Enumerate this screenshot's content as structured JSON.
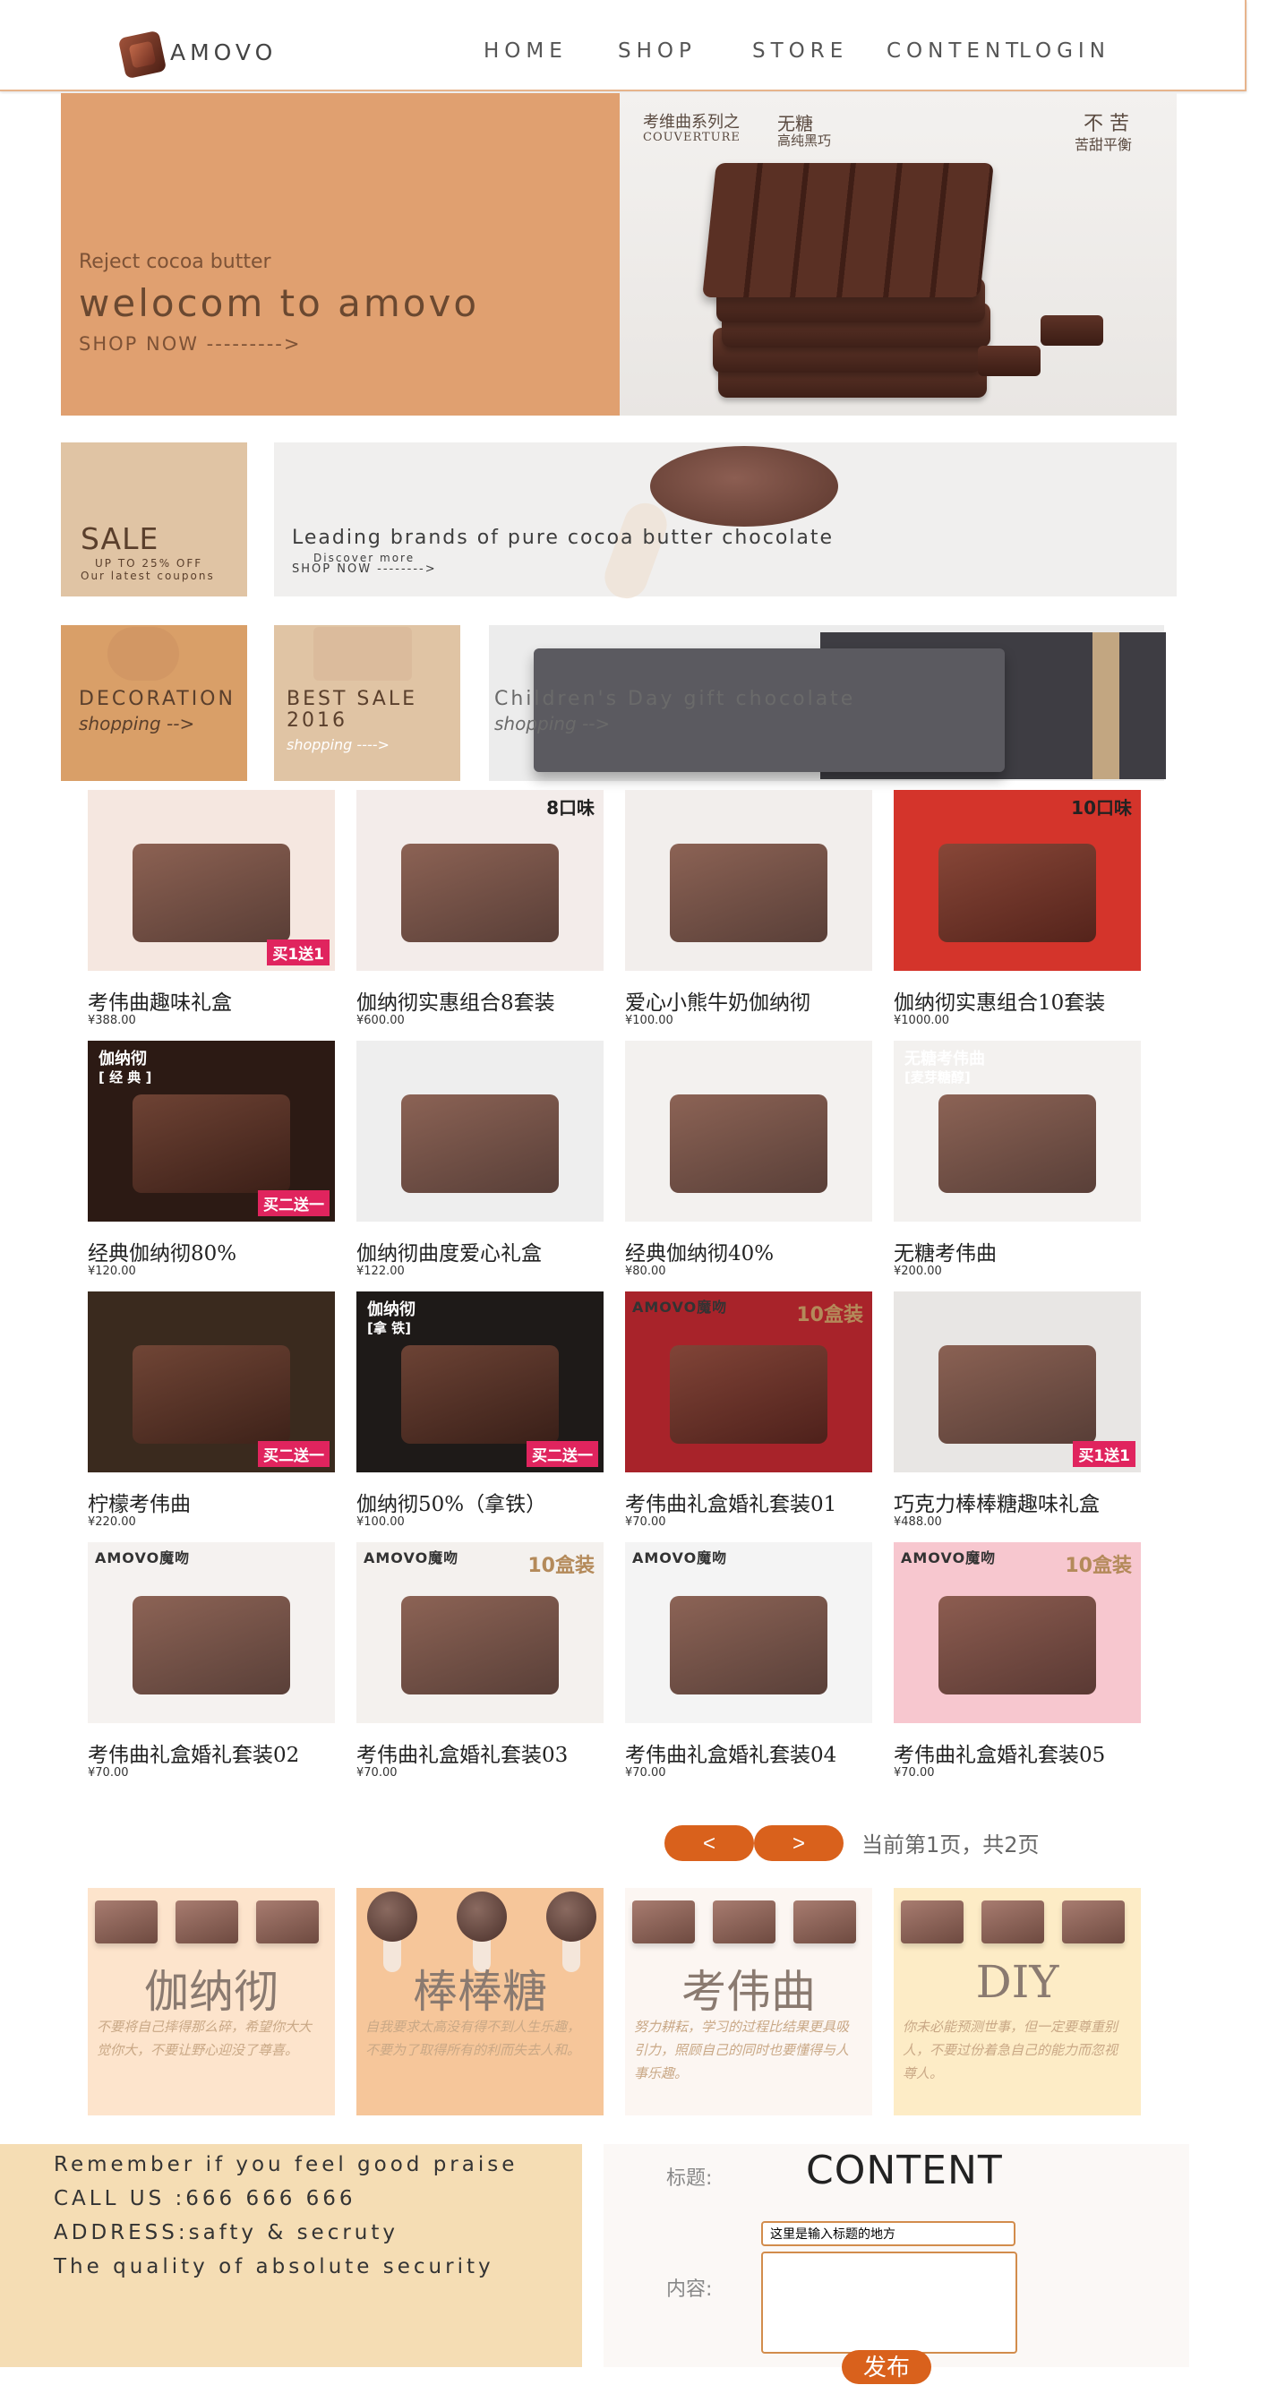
{
  "header": {
    "logo_text": "AMOVO",
    "nav": [
      "HOME",
      "SHOP",
      "STORE",
      "CONTENT",
      "LOGIN"
    ]
  },
  "hero": {
    "subtitle": "Reject cocoa butter",
    "title": "welocom to amovo",
    "shop_link": "SHOP NOW --------->",
    "cn_series": "考维曲系列之",
    "cn_series_en": "COUVERTURE",
    "cn_sugar": "无糖",
    "cn_dark": "高纯黑巧",
    "cn_bitter": "不 苦",
    "cn_balance": "苦甜平衡"
  },
  "promos": {
    "sale_title": "SALE",
    "sale_up": "UP TO 25% OFF",
    "sale_latest": "Our latest coupons",
    "brand_text": "Leading brands of pure cocoa butter chocolate",
    "brand_discover": "Discover more",
    "brand_shop": "SHOP NOW -------->",
    "decoration": "DECORATION",
    "decoration_shop": "shopping -->",
    "best_sale": "BEST SALE",
    "best_year": "2016",
    "best_shop": "shopping ---->",
    "children": "Children's Day gift   chocolate",
    "children_shop": "shopping -->"
  },
  "products": [
    {
      "name": "考伟曲趣味礼盒",
      "price": "¥388.00",
      "badge": "买1送1",
      "bg": "#f5e7e0"
    },
    {
      "name": "伽纳彻实惠组合8套装",
      "price": "¥600.00",
      "corner": "8口味",
      "bg": "#f3ecea"
    },
    {
      "name": "爱心小熊牛奶伽纳彻",
      "price": "¥100.00",
      "bg": "#f2eeec"
    },
    {
      "name": "伽纳彻实惠组合10套装",
      "price": "¥1000.00",
      "corner": "10口味",
      "bg": "#d4342b"
    },
    {
      "name": "经典伽纳彻80%",
      "price": "¥120.00",
      "tag": "伽纳彻",
      "tag2": "[ 经 典 ]",
      "badge": "买二送一",
      "bg": "#2c1a14"
    },
    {
      "name": "伽纳彻曲度爱心礼盒",
      "price": "¥122.00",
      "bg": "#eeeeee"
    },
    {
      "name": "经典伽纳彻40%",
      "price": "¥80.00",
      "bg": "#f3f1ef"
    },
    {
      "name": "无糖考伟曲",
      "price": "¥200.00",
      "tag": "无糖考伟曲",
      "tag2": "[麦芽糖醇]",
      "bg": "#f3f1ef"
    },
    {
      "name": "柠檬考伟曲",
      "price": "¥220.00",
      "badge": "买二送一",
      "bg": "#3a2a1e"
    },
    {
      "name": "伽纳彻50%（拿铁）",
      "price": "¥100.00",
      "tag": "伽纳彻",
      "tag2": "[拿 铁]",
      "badge": "买二送一",
      "bg": "#1e1a18"
    },
    {
      "name": "考伟曲礼盒婚礼套装01",
      "price": "¥70.00",
      "brand": "AMOVO魔吻",
      "wed": "10盒装",
      "bg": "#a8232a"
    },
    {
      "name": "巧克力棒棒糖趣味礼盒",
      "price": "¥488.00",
      "badge": "买1送1",
      "bg": "#e8e6e4"
    },
    {
      "name": "考伟曲礼盒婚礼套装02",
      "price": "¥70.00",
      "brand": "AMOVO魔吻",
      "bg": "#f5f2f0"
    },
    {
      "name": "考伟曲礼盒婚礼套装03",
      "price": "¥70.00",
      "brand": "AMOVO魔吻",
      "wed": "10盒装",
      "bg": "#f4f1ee"
    },
    {
      "name": "考伟曲礼盒婚礼套装04",
      "price": "¥70.00",
      "brand": "AMOVO魔吻",
      "bg": "#f4f4f4"
    },
    {
      "name": "考伟曲礼盒婚礼套装05",
      "price": "¥70.00",
      "brand": "AMOVO魔吻",
      "wed": "10盒装",
      "bg": "#f7c7cf"
    }
  ],
  "pager": {
    "prev": "<",
    "next": ">",
    "info": "当前第1页，共2页"
  },
  "categories": [
    {
      "title": "伽纳彻",
      "desc": "不要将自己摔得那么碎，希望你大大觉你大，不要让野心迎没了尊喜。",
      "bg": "#fde4cc"
    },
    {
      "title": "棒棒糖",
      "desc": "自我要求太高没有得不到人生乐趣，不要为了取得所有的利而失去人和。",
      "bg": "#f6c69a"
    },
    {
      "title": "考伟曲",
      "desc": "努力耕耘，学习的过程比结果更具吸引力，照顾自己的同时也要懂得与人事乐趣。",
      "bg": "#fcf6f2"
    },
    {
      "title": "DIY",
      "desc": "你未必能预测世事，但一定要尊重别人，不要过份着急自己的能力而忽视尊人。",
      "bg": "#fdecc6"
    }
  ],
  "footer": {
    "lines": [
      "Remember if you feel good praise",
      "CALL US :666 666 666",
      "ADDRESS:safty & secruty",
      "The quality of absolute security"
    ],
    "content_title": "CONTENT",
    "title_label": "标题:",
    "title_value": "这里是输入标题的地方",
    "content_label": "内容:",
    "submit": "发布"
  }
}
